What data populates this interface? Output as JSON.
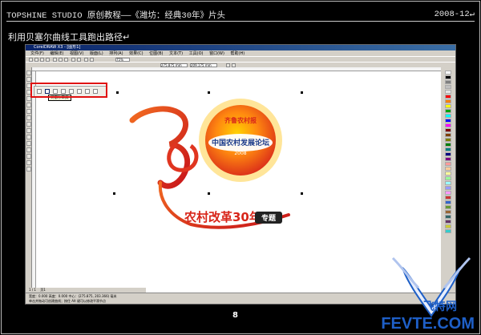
{
  "header": {
    "title": "TOPSHINE STUDIO 原创教程——《潍坊：经典30年》片头",
    "date": "2008-12↵"
  },
  "subtitle": "利用贝塞尔曲线工具跑出路径↵",
  "app": {
    "title": "CorelDRAW X3 - [图形1]",
    "menu": [
      "文件(F)",
      "编辑(E)",
      "视图(V)",
      "版面(L)",
      "排列(A)",
      "效果(C)",
      "位图(B)",
      "文本(T)",
      "工具(O)",
      "窗口(W)",
      "帮助(H)"
    ],
    "zoom": "75%",
    "field_x": "275.875 mm",
    "field_y": "209.175 mm",
    "tooltip": "贝塞尔工具",
    "page_tab": "页1",
    "page_nav": "1 / 1",
    "status_line1": "宽度：0.000 高度：0.000 中心：(275.875, 203.366) 毫米",
    "status_line2": "单击并拖动可创建曲线；按住 Alt 键可以修改平滑节点"
  },
  "logo": {
    "badge_top": "齐鲁农村报",
    "badge_main": "中国农村发展论坛",
    "badge_year": "2008",
    "tagline": "农村改革30年",
    "special": "专题"
  },
  "page_number": "8",
  "watermark": {
    "cn": "飞特网",
    "en": "FEVTE.COM"
  },
  "colors": {
    "accent_red": "#e01010",
    "logo_red": "#d8261a",
    "logo_orange": "#f26b21",
    "badge_yellow": "#ffd200",
    "watermark_blue": "#1e5fc7"
  }
}
